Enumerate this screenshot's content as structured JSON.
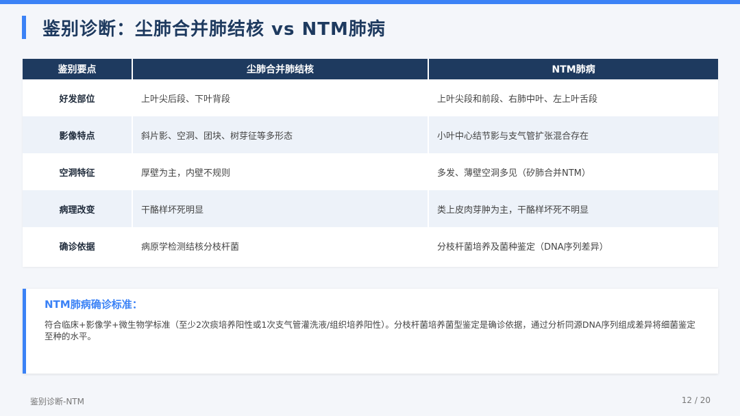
{
  "title": "鉴别诊断：尘肺合并肺结核 vs NTM肺病",
  "colors": {
    "accent": "#3b82f6",
    "header_bg": "#1e3a5f",
    "stripe": "#edf2f9"
  },
  "table": {
    "headers": [
      "鉴别要点",
      "尘肺合并肺结核",
      "NTM肺病"
    ],
    "rows": [
      {
        "key": "好发部位",
        "tb": "上叶尖后段、下叶背段",
        "ntm": "上叶尖段和前段、右肺中叶、左上叶舌段"
      },
      {
        "key": "影像特点",
        "tb": "斜片影、空洞、团块、树芽征等多形态",
        "ntm": "小叶中心结节影与支气管扩张混合存在"
      },
      {
        "key": "空洞特征",
        "tb": "厚壁为主，内壁不规则",
        "ntm": "多发、薄壁空洞多见（矽肺合并NTM）"
      },
      {
        "key": "病理改变",
        "tb": "干酪样坏死明显",
        "ntm": "类上皮肉芽肿为主，干酪样坏死不明显"
      },
      {
        "key": "确诊依据",
        "tb": "病原学检测结核分枝杆菌",
        "ntm": "分枝杆菌培养及菌种鉴定（DNA序列差异）"
      }
    ]
  },
  "note": {
    "title": "NTM肺病确诊标准：",
    "body": "符合临床+影像学+微生物学标准（至少2次痰培养阳性或1次支气管灌洗液/组织培养阳性）。分枝杆菌培养菌型鉴定是确诊依据，通过分析同源DNA序列组成差异将细菌鉴定至种的水平。"
  },
  "footer": {
    "left": "鉴别诊断-NTM",
    "right": "12 / 20"
  }
}
